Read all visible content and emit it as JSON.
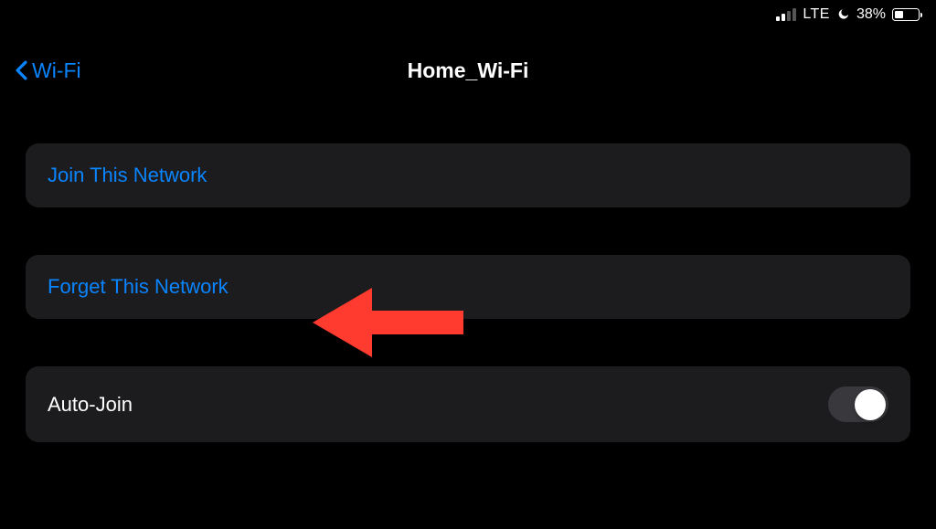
{
  "status_bar": {
    "carrier": "LTE",
    "battery_percent": "38%",
    "battery_fill_percent": 38,
    "signal_active_bars": 2
  },
  "nav": {
    "back_label": "Wi-Fi",
    "title": "Home_Wi-Fi"
  },
  "cells": {
    "join": "Join This Network",
    "forget": "Forget This Network",
    "autojoin": "Auto-Join"
  },
  "autojoin_on": false,
  "annotation": {
    "arrow_color": "#ff3b30"
  }
}
